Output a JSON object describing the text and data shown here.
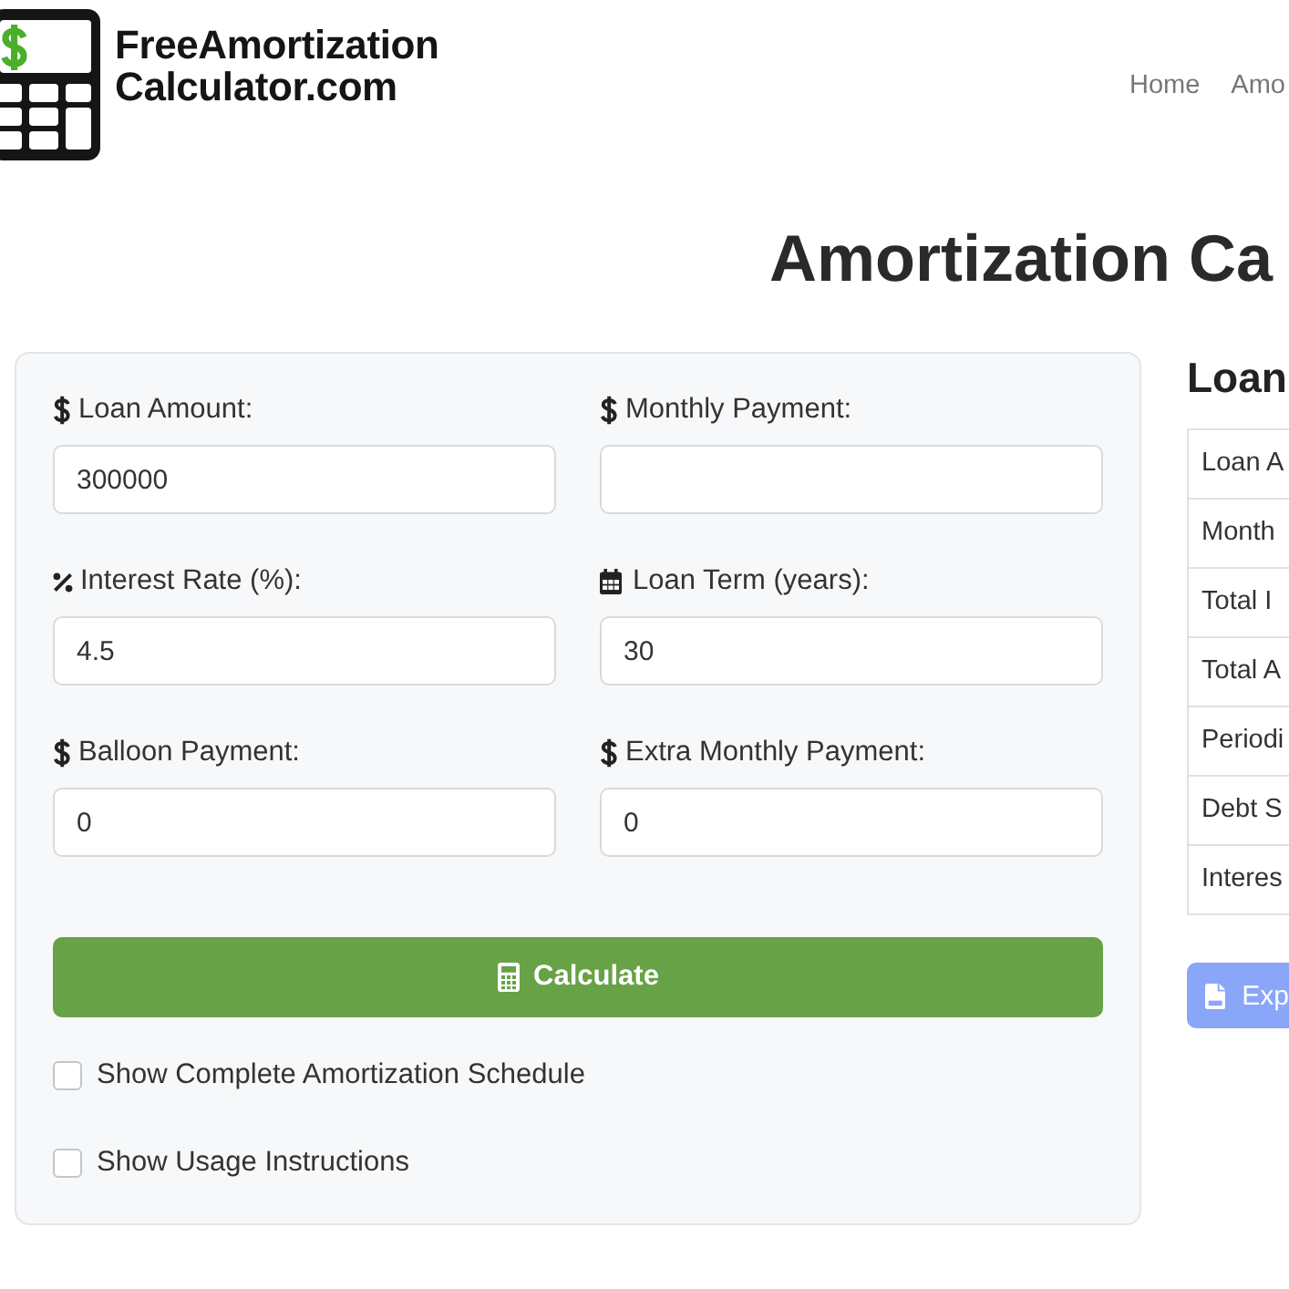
{
  "logo": {
    "lines": [
      "FreeAmortization",
      "Calculator.com"
    ]
  },
  "nav": [
    {
      "label": "Home"
    },
    {
      "label": "Amo"
    }
  ],
  "page_title": "Amortization Ca",
  "form": {
    "fields": [
      {
        "label": "Loan Amount:",
        "value": "300000"
      },
      {
        "label": "Monthly Payment:"
      },
      {
        "label": "Interest Rate (%):",
        "value": "4.5"
      },
      {
        "label": "Loan Term (years):",
        "value": "30"
      },
      {
        "label": "Balloon Payment:",
        "value": "0"
      },
      {
        "label": "Extra Monthly Payment:",
        "value": "0"
      }
    ],
    "calculate_button": "Calculate",
    "checkboxes": [
      {
        "label": "Show Complete Amortization Schedule",
        "checked": false
      },
      {
        "label": "Show Usage Instructions",
        "checked": false
      }
    ]
  },
  "summary": {
    "heading": "Loan",
    "rows": [
      {
        "label": "Loan A"
      },
      {
        "label": "Month"
      },
      {
        "label": "Total I"
      },
      {
        "label": "Total A"
      },
      {
        "label": "Periodi"
      },
      {
        "label": "Debt S"
      },
      {
        "label": "Interes"
      }
    ],
    "export_button": {
      "label": "Exp",
      "disabled": true
    }
  }
}
